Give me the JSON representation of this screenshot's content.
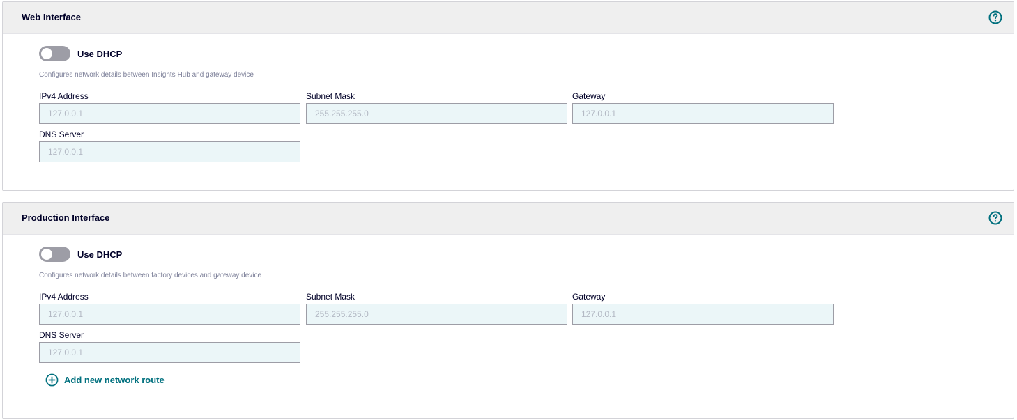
{
  "web_interface": {
    "title": "Web Interface",
    "toggle_label": "Use DHCP",
    "toggle_on": false,
    "description": "Configures network details between Insights Hub and gateway device",
    "fields": {
      "ipv4": {
        "label": "IPv4 Address",
        "placeholder": "127.0.0.1"
      },
      "subnet": {
        "label": "Subnet Mask",
        "placeholder": "255.255.255.0"
      },
      "gateway": {
        "label": "Gateway",
        "placeholder": "127.0.0.1"
      },
      "dns": {
        "label": "DNS Server",
        "placeholder": "127.0.0.1"
      }
    }
  },
  "production_interface": {
    "title": "Production Interface",
    "toggle_label": "Use DHCP",
    "toggle_on": false,
    "description": "Configures network details between factory devices and gateway device",
    "fields": {
      "ipv4": {
        "label": "IPv4 Address",
        "placeholder": "127.0.0.1"
      },
      "subnet": {
        "label": "Subnet Mask",
        "placeholder": "255.255.255.0"
      },
      "gateway": {
        "label": "Gateway",
        "placeholder": "127.0.0.1"
      },
      "dns": {
        "label": "DNS Server",
        "placeholder": "127.0.0.1"
      }
    },
    "add_route_label": "Add new network route"
  },
  "icons": {
    "help": "help-circle-icon",
    "add": "plus-circle-icon"
  },
  "colors": {
    "accent": "#00707e",
    "header_bg": "#efefef",
    "input_bg": "#ebf6f8",
    "toggle_off": "#9d9da6"
  }
}
